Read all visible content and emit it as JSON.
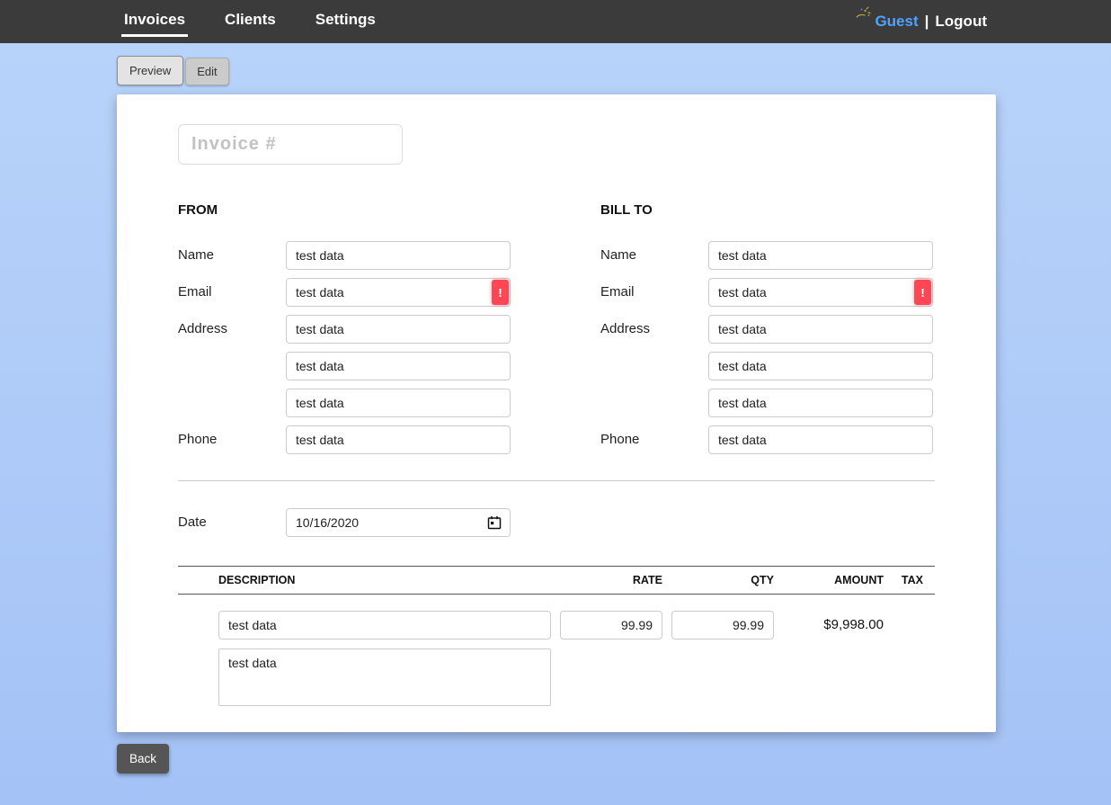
{
  "nav": {
    "tabs": [
      {
        "label": "Invoices"
      },
      {
        "label": "Clients"
      },
      {
        "label": "Settings"
      }
    ],
    "user": {
      "name": "Guest",
      "separator": "|",
      "logout": "Logout"
    }
  },
  "view_tabs": {
    "preview_label": "Preview",
    "edit_label": "Edit"
  },
  "invoice": {
    "number_placeholder": "Invoice #",
    "from": {
      "heading": "FROM",
      "name_label": "Name",
      "name_value": "test data",
      "email_label": "Email",
      "email_value": "test data",
      "email_error": "!",
      "address_label": "Address",
      "address1_value": "test data",
      "address2_value": "test data",
      "address3_value": "test data",
      "phone_label": "Phone",
      "phone_value": "test data"
    },
    "bill_to": {
      "heading": "BILL TO",
      "name_label": "Name",
      "name_value": "test data",
      "email_label": "Email",
      "email_value": "test data",
      "email_error": "!",
      "address_label": "Address",
      "address1_value": "test data",
      "address2_value": "test data",
      "address3_value": "test data",
      "phone_label": "Phone",
      "phone_value": "test data"
    },
    "date": {
      "label": "Date",
      "value": "10/16/2020"
    },
    "items_table": {
      "headers": {
        "description": "DESCRIPTION",
        "rate": "RATE",
        "qty": "QTY",
        "amount": "AMOUNT",
        "tax": "TAX"
      },
      "rows": [
        {
          "description": "test data",
          "rate": "99.99",
          "qty": "99.99",
          "amount": "$9,998.00",
          "notes": "test data"
        }
      ]
    }
  },
  "back_label": "Back",
  "colors": {
    "nav_bg": "#3b3b3b",
    "guest_blue": "#4da3ff",
    "error_red": "#ff4655"
  }
}
